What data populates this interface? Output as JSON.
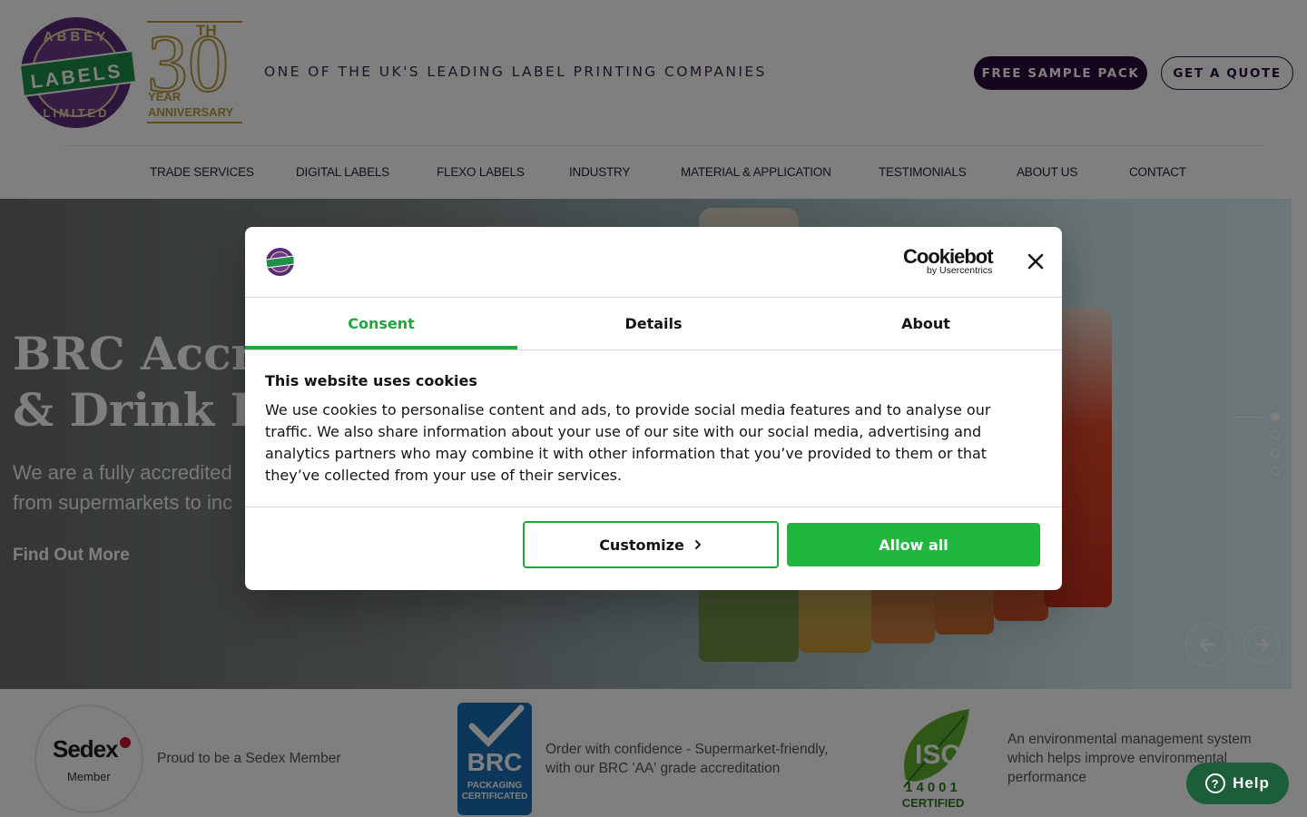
{
  "header": {
    "logo_text_top": "ABBEY",
    "logo_text_band": "LABELS",
    "logo_text_bottom": "LIMITED",
    "anniversary_number": "30",
    "anniversary_suffix": "TH",
    "anniversary_line1": "YEAR",
    "anniversary_line2": "ANNIVERSARY",
    "tagline": "ONE OF THE UK'S LEADING LABEL PRINTING COMPANIES",
    "sample_button": "FREE SAMPLE PACK",
    "quote_button": "GET A QUOTE"
  },
  "nav": {
    "items": [
      "TRADE SERVICES",
      "DIGITAL LABELS",
      "FLEXO LABELS",
      "INDUSTRY",
      "MATERIAL & APPLICATION",
      "TESTIMONIALS",
      "ABOUT US",
      "CONTACT"
    ]
  },
  "hero": {
    "title_line1": "BRC Accr",
    "title_line2": "& Drink L",
    "subtitle_line1": "We are a fully accredited",
    "subtitle_line2": "from supermarkets to inc",
    "link": "Find Out More",
    "slide_count": 4,
    "active_slide": 1,
    "prev_icon": "arrow-left-icon",
    "next_icon": "arrow-right-icon"
  },
  "strip": {
    "sedex_logo": "Sedex",
    "sedex_member": "Member",
    "sedex_text": "Proud to be a Sedex Member",
    "brc_logo": "BRC",
    "brc_badge_line1": "PACKAGING",
    "brc_badge_line2": "CERTIFICATED",
    "brc_text_line1": "Order with confidence - Supermarket-friendly,",
    "brc_text_line2": "with our BRC 'AA' grade accreditation",
    "iso_logo": "ISO",
    "iso_number": "14001",
    "iso_certified": "CERTIFIED",
    "iso_text_line1": "An environmental management system",
    "iso_text_line2": "which helps improve environmental",
    "iso_text_line3": "performance"
  },
  "help": {
    "label": "Help",
    "icon": "question-icon"
  },
  "cookie_dialog": {
    "brand_word": "Cookiebot",
    "brand_by": "by Usercentrics",
    "close_icon": "close-icon",
    "tabs": [
      "Consent",
      "Details",
      "About"
    ],
    "active_tab": "Consent",
    "heading": "This website uses cookies",
    "body_line1": "We use cookies to personalise content and ads, to provide social media features and to analyse our",
    "body_line2": "traffic. We also share information about your use of our site with our social media, advertising and",
    "body_line3": "analytics partners who may combine it with other information that you’ve provided to them or that",
    "body_line4": "they’ve collected from your use of their services.",
    "customize_button": "Customize",
    "customize_icon": "chevron-right-icon",
    "allow_button": "Allow all"
  },
  "colors": {
    "brand_purple": "#2b0d3d",
    "brand_green": "#1fb83d",
    "consent_green": "#1fa83f",
    "gold": "#b89a3e",
    "help_green": "#1c5e3a"
  }
}
